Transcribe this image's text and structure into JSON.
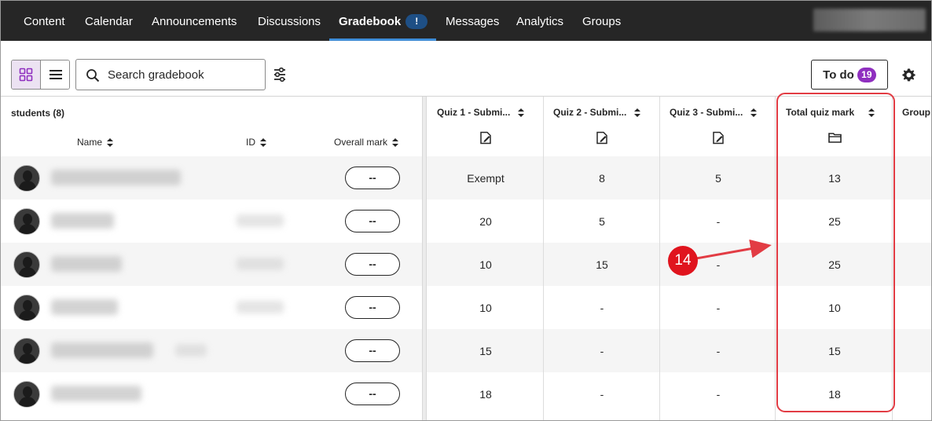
{
  "nav": {
    "items": [
      {
        "label": "Content"
      },
      {
        "label": "Calendar"
      },
      {
        "label": "Announcements"
      },
      {
        "label": "Discussions"
      },
      {
        "label": "Gradebook",
        "badge": "!"
      },
      {
        "label": "Messages"
      },
      {
        "label": "Analytics"
      },
      {
        "label": "Groups"
      }
    ],
    "active": "Gradebook"
  },
  "toolbar": {
    "search_placeholder": "Search gradebook",
    "todo_label": "To do",
    "todo_count": "19",
    "active_view": "grid"
  },
  "grid": {
    "students_label": "students (8)",
    "columns": {
      "name": "Name",
      "id": "ID",
      "overall": "Overall mark",
      "quiz1": "Quiz 1 - Submi...",
      "quiz2": "Quiz 2 - Submi...",
      "quiz3": "Quiz 3 - Submi...",
      "total": "Total quiz mark",
      "group": "Group"
    },
    "rows": [
      {
        "overall": "--",
        "quiz1": "Exempt",
        "quiz2": "8",
        "quiz3": "5",
        "total": "13"
      },
      {
        "overall": "--",
        "quiz1": "20",
        "quiz2": "5",
        "quiz3": "-",
        "total": "25"
      },
      {
        "overall": "--",
        "quiz1": "10",
        "quiz2": "15",
        "quiz3": "-",
        "total": "25"
      },
      {
        "overall": "--",
        "quiz1": "10",
        "quiz2": "-",
        "quiz3": "-",
        "total": "10"
      },
      {
        "overall": "--",
        "quiz1": "15",
        "quiz2": "-",
        "quiz3": "-",
        "total": "15"
      },
      {
        "overall": "--",
        "quiz1": "18",
        "quiz2": "-",
        "quiz3": "-",
        "total": "18"
      }
    ]
  },
  "annotation": {
    "callout_number": "14",
    "color": "#e0141e"
  },
  "colors": {
    "nav_bg": "#262626",
    "active_underline": "#3f8ed8",
    "todo_badge": "#8f2fbf",
    "grid_view_bg": "#ece2f2"
  }
}
